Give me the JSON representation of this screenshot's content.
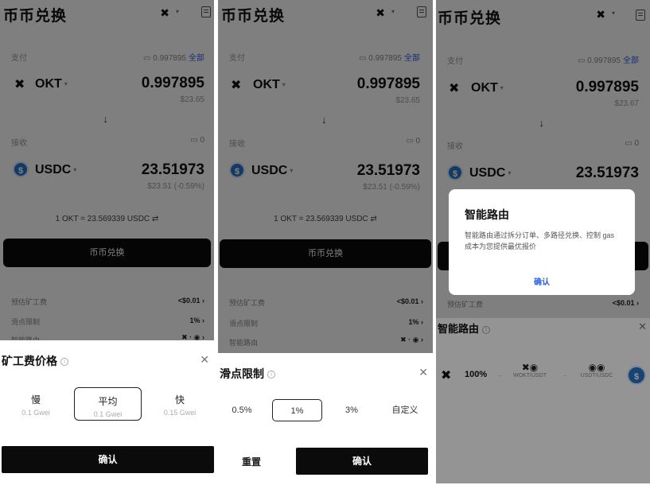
{
  "panels": [
    {
      "title": "币币兑换",
      "from_label": "支付",
      "from_balance": "0.997895",
      "all_label": "全部",
      "from_token": "OKT",
      "from_amount": "0.997895",
      "from_fiat": "$23.65",
      "to_label": "接收",
      "to_balance": "0",
      "to_token": "USDC",
      "to_amount": "23.51973",
      "to_fiat": "$23.51 (-0.59%)",
      "rate": "1 OKT = 23.569339 USDC",
      "swap_button": "币币兑换",
      "rows": [
        {
          "label": "预估矿工费",
          "value": "<$0.01"
        },
        {
          "label": "滑点限制",
          "value": "1%"
        },
        {
          "label": "智能路由",
          "value": ""
        }
      ]
    },
    {
      "title": "币币兑换",
      "from_label": "支付",
      "from_balance": "0.997895",
      "all_label": "全部",
      "from_token": "OKT",
      "from_amount": "0.997895",
      "from_fiat": "$23.65",
      "to_label": "接收",
      "to_balance": "0",
      "to_token": "USDC",
      "to_amount": "23.51973",
      "to_fiat": "$23.51 (-0.59%)",
      "rate": "1 OKT = 23.569339 USDC",
      "swap_button": "币币兑换",
      "rows": [
        {
          "label": "预估矿工费",
          "value": "<$0.01"
        },
        {
          "label": "滑点限制",
          "value": "1%"
        },
        {
          "label": "智能路由",
          "value": ""
        }
      ]
    },
    {
      "title": "币币兑换",
      "from_label": "支付",
      "from_balance": "0.997895",
      "all_label": "全部",
      "from_token": "OKT",
      "from_amount": "0.997895",
      "from_fiat": "$23.67",
      "to_label": "接收",
      "to_balance": "0",
      "to_token": "USDC",
      "to_amount": "23.51973",
      "to_fiat": "",
      "rows": [
        {
          "label": "预估矿工费",
          "value": "<$0.01"
        }
      ]
    }
  ],
  "gas_sheet": {
    "title": "矿工费价格",
    "options": [
      {
        "name": "慢",
        "sub": "0.1 Gwei"
      },
      {
        "name": "平均",
        "sub": "0.1 Gwei"
      },
      {
        "name": "快",
        "sub": "0.15 Gwei"
      }
    ],
    "selected": 1,
    "confirm": "确认"
  },
  "slippage_sheet": {
    "title": "滑点限制",
    "options": [
      "0.5%",
      "1%",
      "3%",
      "自定义"
    ],
    "selected": 1,
    "reset": "重置",
    "confirm": "确认"
  },
  "route_dialog": {
    "title": "智能路由",
    "body": "智能路由通过拆分订单、多路径兑换、控制 gas 成本为您提供最优报价",
    "confirm": "确认"
  },
  "route_section": {
    "title": "智能路由",
    "percent": "100%",
    "hop1_pair": "WOKT/USDT",
    "hop2_pair": "USDT/USDC"
  },
  "colors": {
    "overlay": "rgba(0,0,0,0.5)",
    "primary_button": "#0b0b0b",
    "link_blue": "#2b5ee3",
    "usdc_blue": "#2775ca"
  }
}
